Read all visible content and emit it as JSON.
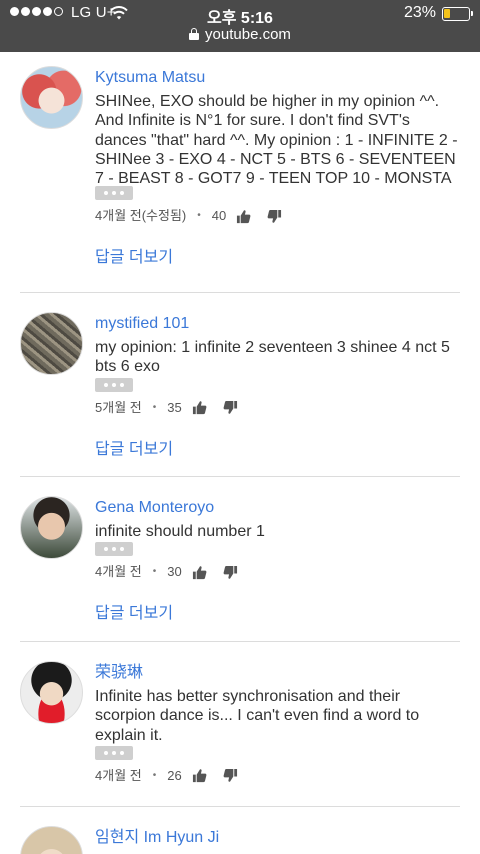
{
  "status_bar": {
    "carrier": "LG U+",
    "time": "오후 5:16",
    "battery_percent": "23%",
    "battery_level": 0.23,
    "url": "youtube.com"
  },
  "icons": {
    "like": "thumbs-up-icon",
    "dislike": "thumbs-down-icon",
    "more": "more-dots-icon"
  },
  "colors": {
    "status_bar_bg": "#4a4a4a",
    "link": "#3b78d8",
    "battery": "#f2c21b"
  },
  "comments": [
    {
      "author": "Kytsuma Matsu",
      "text": "SHINee, EXO should be higher in my opinion ^^. And Infinite is N°1 for sure. I don't find SVT's dances \"that\" hard ^^. My opinion : 1 - INFINITE 2 - SHINee 3 - EXO 4 - NCT 5 - BTS 6 - SEVENTEEN 7 - BEAST 8 - GOT7 9 - TEEN TOP 10 - MONSTA X",
      "time": "4개월 전(수정됨)",
      "likes": "40",
      "reply_label": "답글 더보기"
    },
    {
      "author": "mystified 101",
      "text": "my opinion: 1 infinite 2 seventeen 3 shinee 4 nct 5 bts 6 exo",
      "time": "5개월 전",
      "likes": "35",
      "reply_label": "답글 더보기"
    },
    {
      "author": "Gena Monteroyo",
      "text": "infinite should number 1",
      "time": "4개월 전",
      "likes": "30",
      "reply_label": "답글 더보기"
    },
    {
      "author": "荣骁琳",
      "text": "Infinite has better synchronisation and their scorpion dance is... I can't even find a word to explain it.",
      "time": "4개월 전",
      "likes": "26"
    },
    {
      "author": "임현지 Im Hyun Ji"
    }
  ]
}
